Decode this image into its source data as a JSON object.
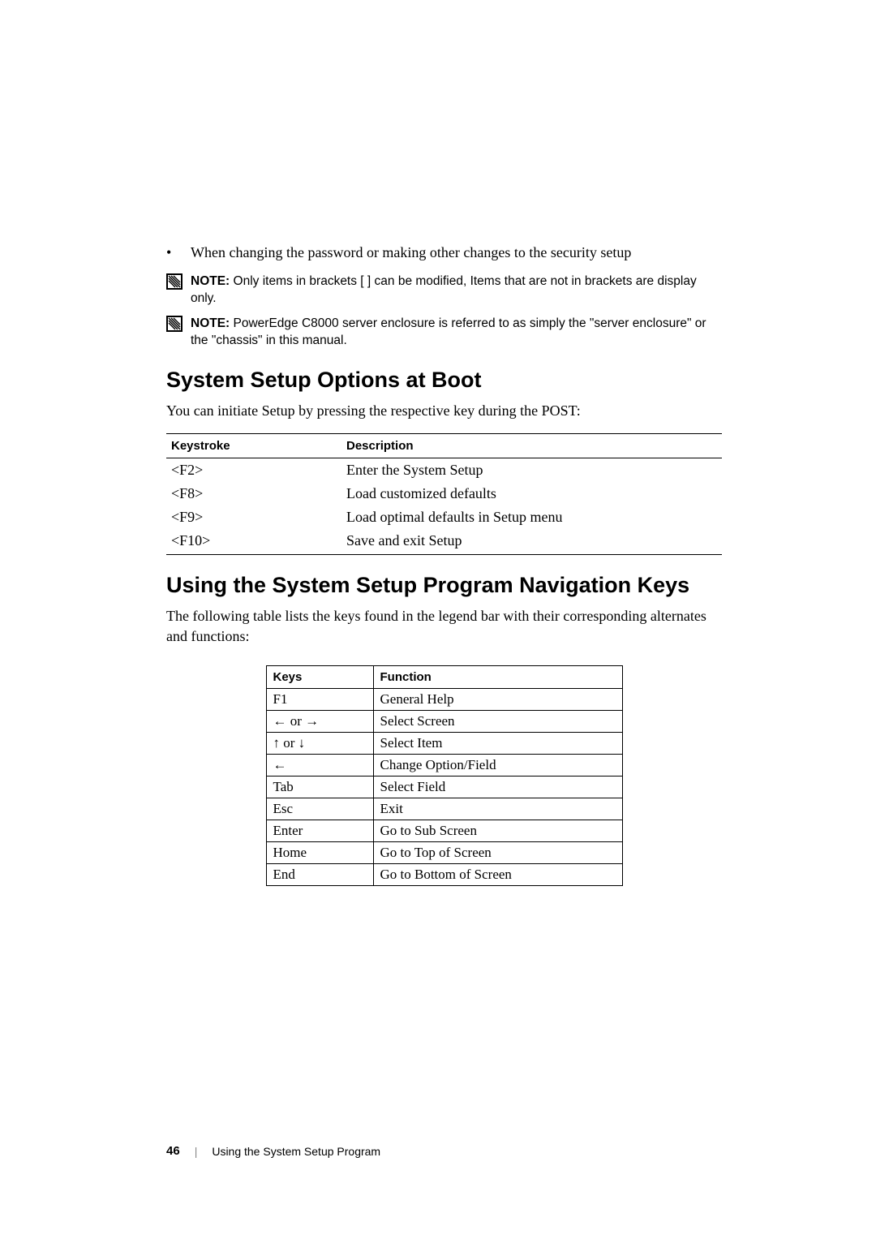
{
  "bullet": {
    "text": "When changing the password or making other changes to the security setup"
  },
  "notes": [
    {
      "label": "NOTE:",
      "text": " Only items in brackets [ ] can be modified, Items that are not in brackets are display only."
    },
    {
      "label": "NOTE:",
      "text": " PowerEdge C8000 server enclosure is referred to as simply the \"server enclosure\" or the \"chassis\" in this manual."
    }
  ],
  "section1": {
    "heading": "System Setup Options at Boot",
    "intro": "You can initiate Setup by pressing the respective key during the POST:",
    "headers": {
      "col1": "Keystroke",
      "col2": "Description"
    },
    "rows": [
      {
        "keystroke": "<F2>",
        "desc": "Enter the System Setup"
      },
      {
        "keystroke": "<F8>",
        "desc": "Load customized defaults"
      },
      {
        "keystroke": "<F9>",
        "desc": "Load optimal defaults in Setup menu"
      },
      {
        "keystroke": "<F10>",
        "desc": "Save and exit Setup"
      }
    ]
  },
  "section2": {
    "heading": "Using the System Setup Program Navigation Keys",
    "intro": "The following table lists the keys found in the legend bar with their corresponding alternates and functions:",
    "headers": {
      "col1": "Keys",
      "col2": "Function"
    },
    "rows": [
      {
        "keys": "F1",
        "func": "General Help"
      },
      {
        "keys": "← or →",
        "func": "Select Screen"
      },
      {
        "keys": "↑ or ↓",
        "func": "Select Item"
      },
      {
        "keys": "←",
        "func": "Change Option/Field"
      },
      {
        "keys": "Tab",
        "func": "Select Field"
      },
      {
        "keys": "Esc",
        "func": "Exit"
      },
      {
        "keys": "Enter",
        "func": "Go to Sub Screen"
      },
      {
        "keys": "Home",
        "func": "Go to Top of Screen"
      },
      {
        "keys": "End",
        "func": "Go to Bottom of Screen"
      }
    ]
  },
  "footer": {
    "page": "46",
    "separator": "|",
    "title": "Using the System Setup Program"
  }
}
